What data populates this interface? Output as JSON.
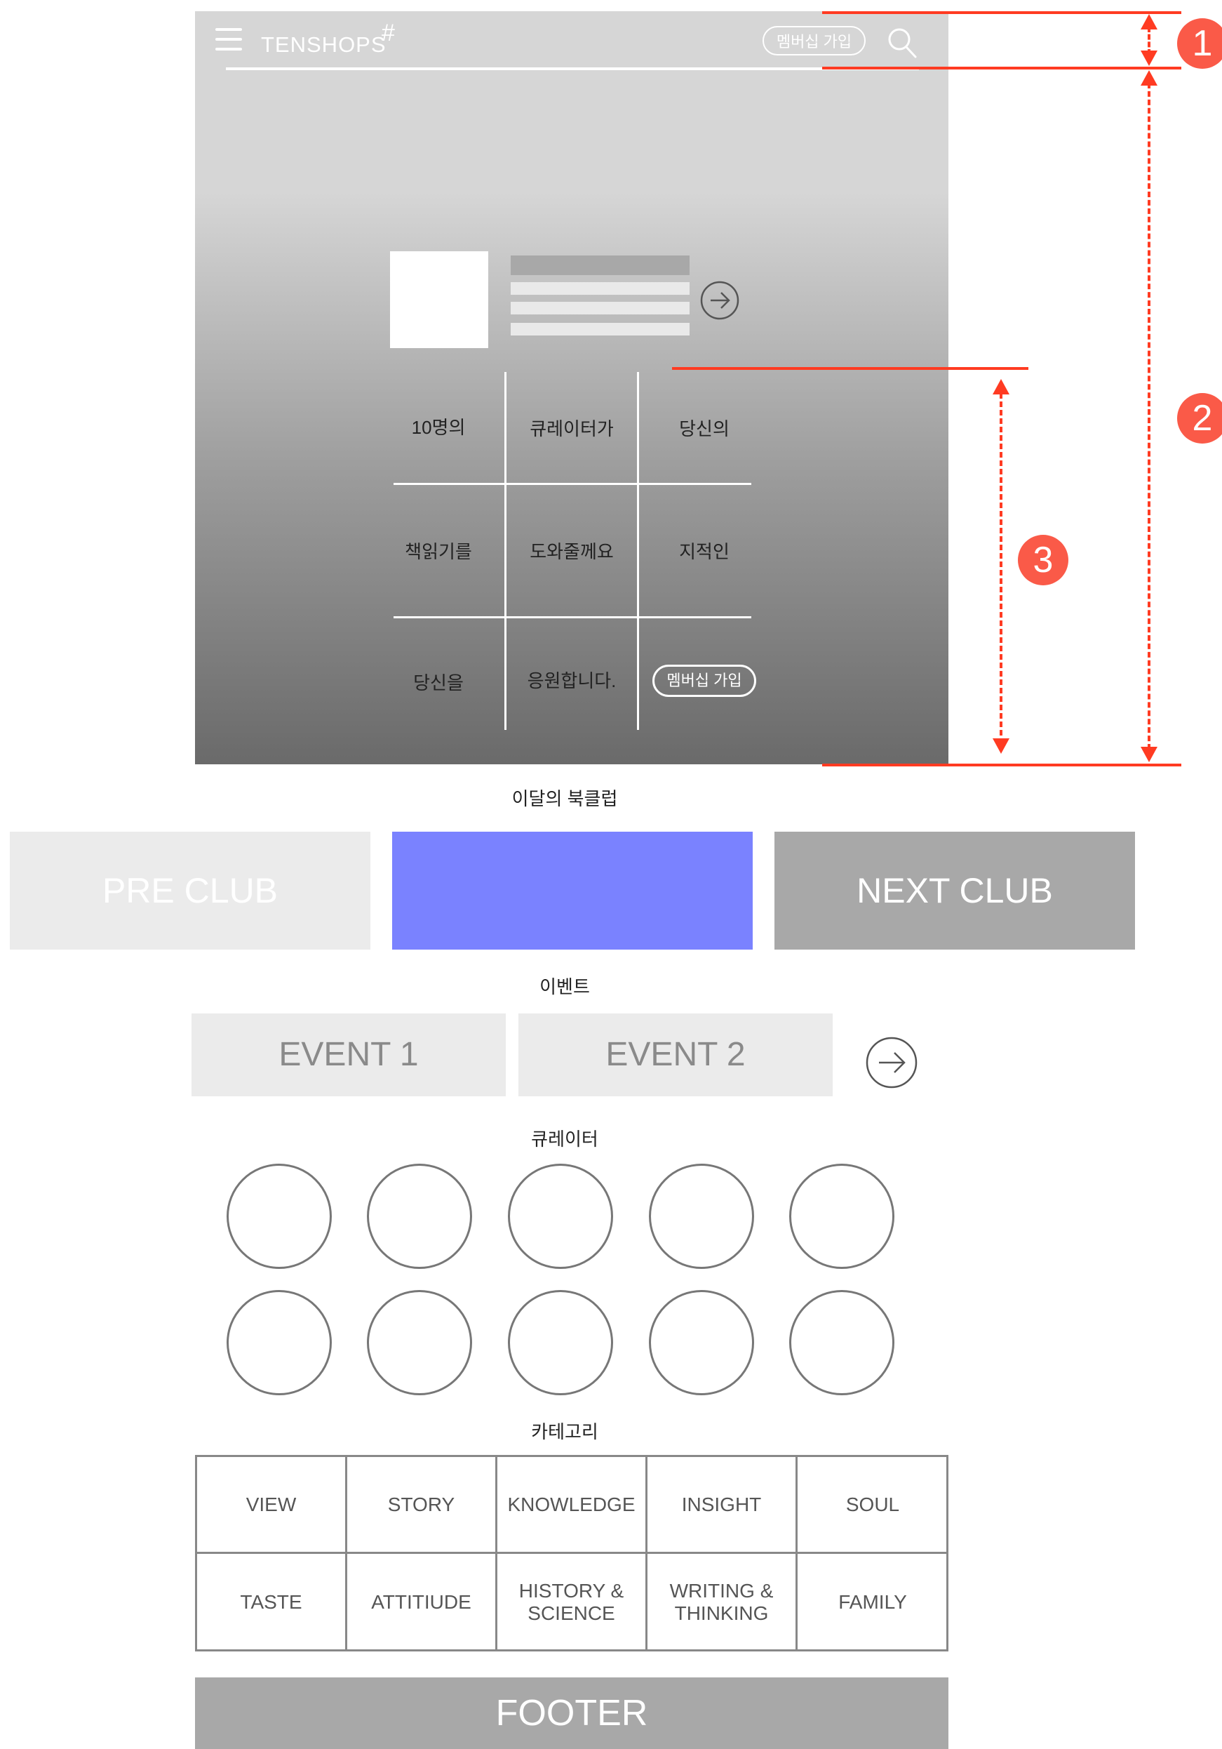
{
  "header": {
    "logo": "TENSHOPS",
    "logo_mark": "#",
    "join_button": "멤버십 가입",
    "icons": [
      "menu-icon",
      "search-icon"
    ]
  },
  "hero": {
    "grid": [
      [
        "10명의",
        "큐레이터가",
        "당신의"
      ],
      [
        "책읽기를",
        "도와줄께요",
        "지적인"
      ],
      [
        "당신을",
        "응원합니다.",
        "멤버십 가입"
      ]
    ]
  },
  "annotations": [
    "1",
    "2",
    "3"
  ],
  "book_club": {
    "title": "이달의 북클럽",
    "prev": "PRE CLUB",
    "next": "NEXT CLUB",
    "colors": {
      "prev": "#ebebeb",
      "current": "#7a82ff",
      "next": "#a8a8a8"
    }
  },
  "events": {
    "title": "이벤트",
    "items": [
      "EVENT 1",
      "EVENT 2"
    ]
  },
  "curators": {
    "title": "큐레이터"
  },
  "categories": {
    "title": "카테고리",
    "items": [
      "VIEW",
      "STORY",
      "KNOWLEDGE",
      "INSIGHT",
      "SOUL",
      "TASTE",
      "ATTITIUDE",
      "HISTORY &\nSCIENCE",
      "WRITING &\nTHINKING",
      "FAMILY"
    ]
  },
  "footer": {
    "label": "FOOTER"
  }
}
